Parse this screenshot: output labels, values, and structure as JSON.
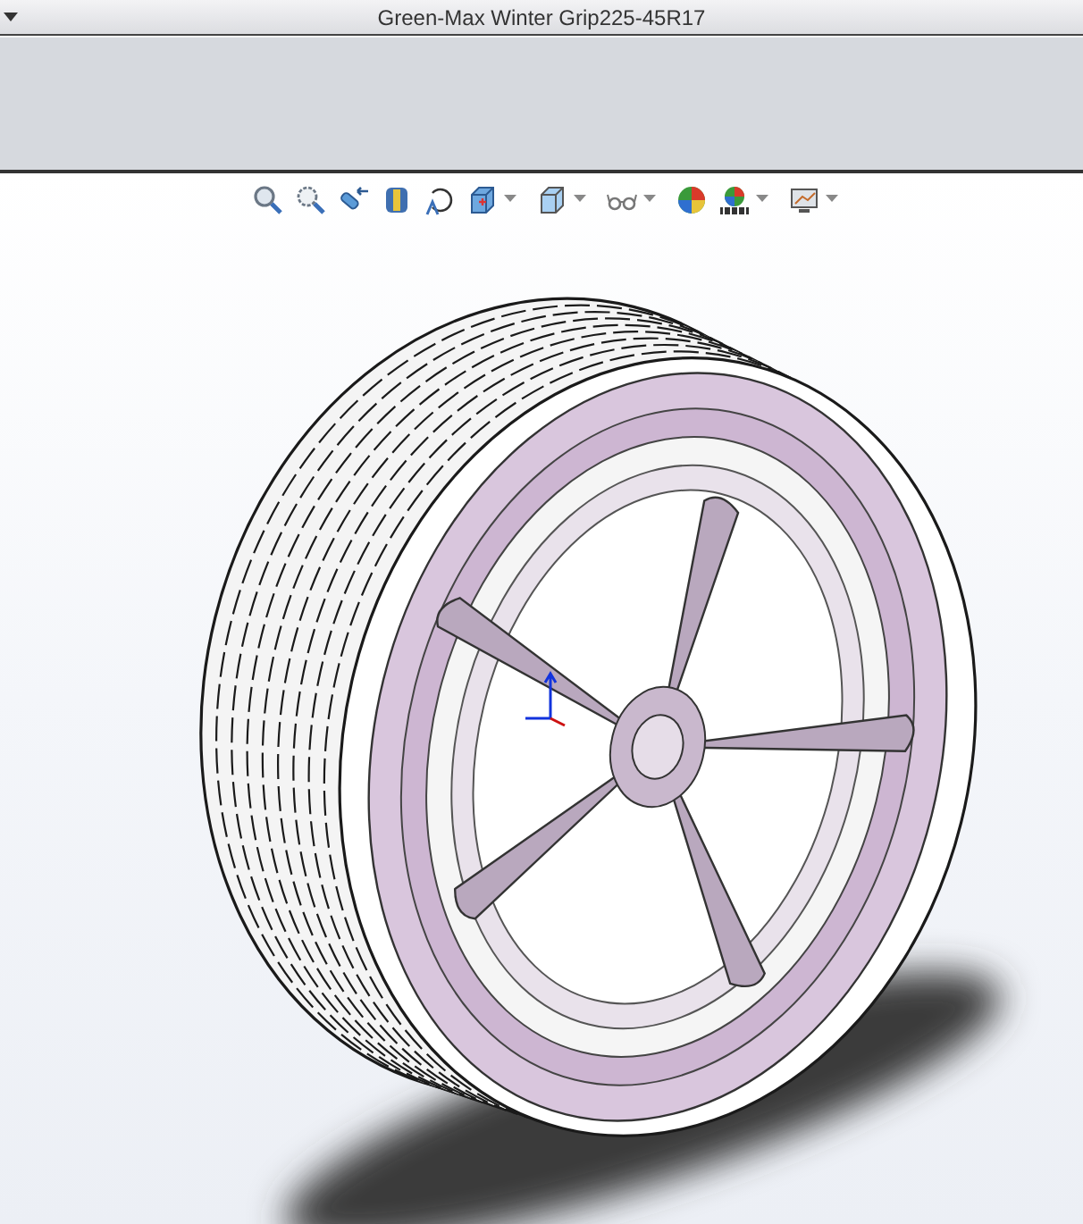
{
  "window": {
    "title": "Green-Max Winter Grip225-45R17"
  },
  "toolbar": {
    "buttons": [
      {
        "dropdown": false
      },
      {
        "dropdown": false
      },
      {
        "dropdown": false
      },
      {
        "dropdown": false
      },
      {
        "dropdown": false
      },
      {
        "dropdown": true
      },
      {
        "dropdown": true
      },
      {
        "dropdown": true
      },
      {
        "dropdown": false
      },
      {
        "dropdown": true
      },
      {
        "dropdown": true
      }
    ]
  }
}
